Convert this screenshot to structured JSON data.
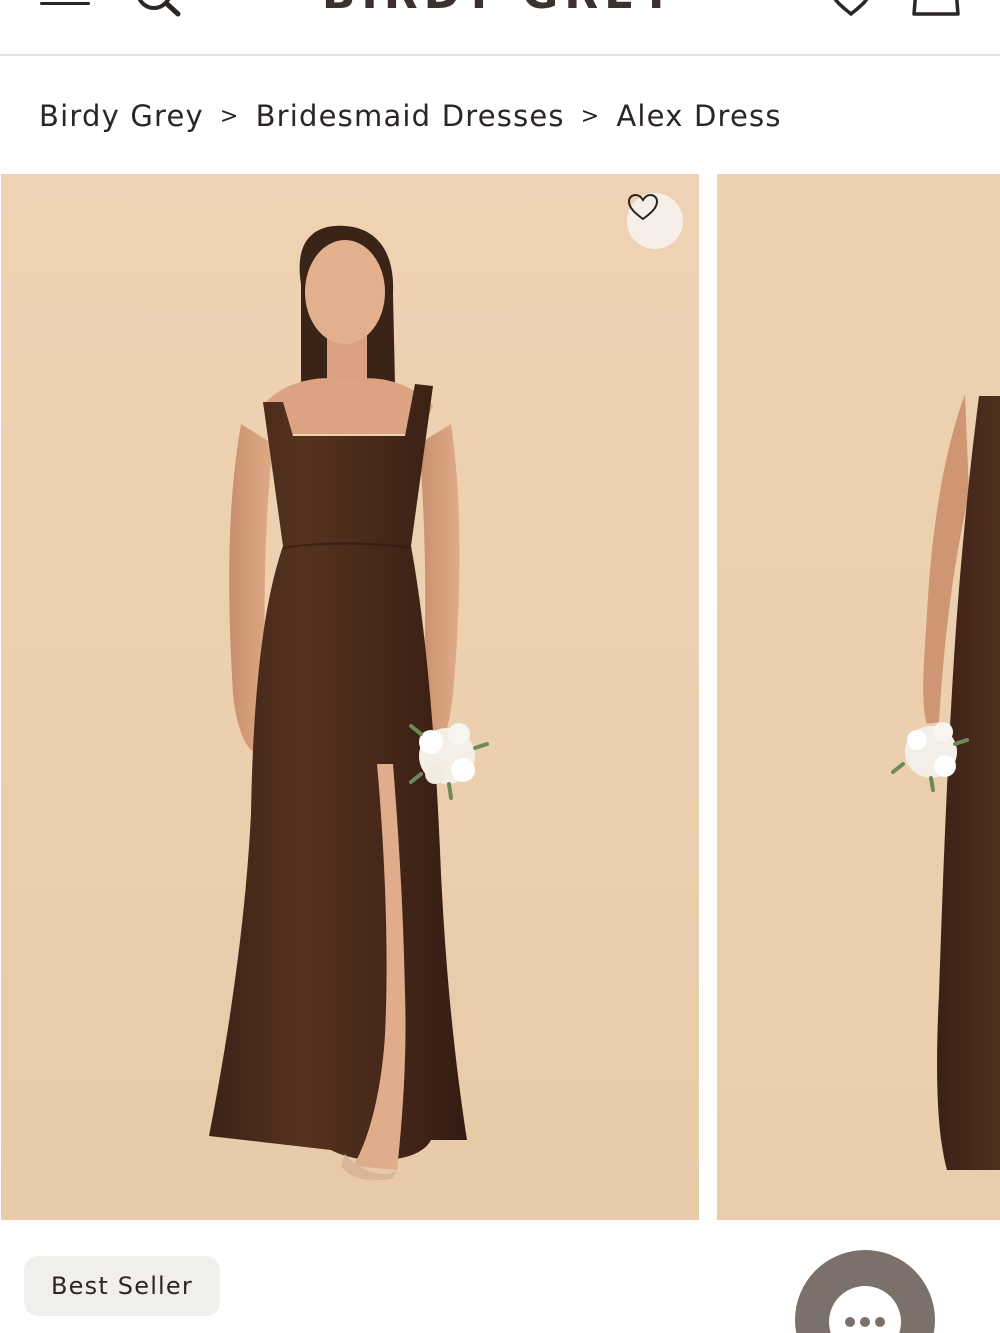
{
  "header": {
    "logo": "BIRDY GREY",
    "icons": [
      "menu-icon",
      "search-icon",
      "heart-icon",
      "bag-icon"
    ]
  },
  "breadcrumb": {
    "items": [
      "Birdy Grey",
      "Bridesmaid Dresses",
      "Alex Dress"
    ],
    "separator": ">"
  },
  "gallery": {
    "images": [
      {
        "alt": "Alex Dress front view"
      },
      {
        "alt": "Alex Dress alternate view"
      }
    ]
  },
  "badge": {
    "label": "Best Seller"
  },
  "colors": {
    "text": "#2b2523",
    "background": "#ffffff",
    "photo_backdrop": "#ecd0b0",
    "dress": "#4a2a1c",
    "chat_button": "#7c706b",
    "badge_bg": "#f1efec"
  }
}
